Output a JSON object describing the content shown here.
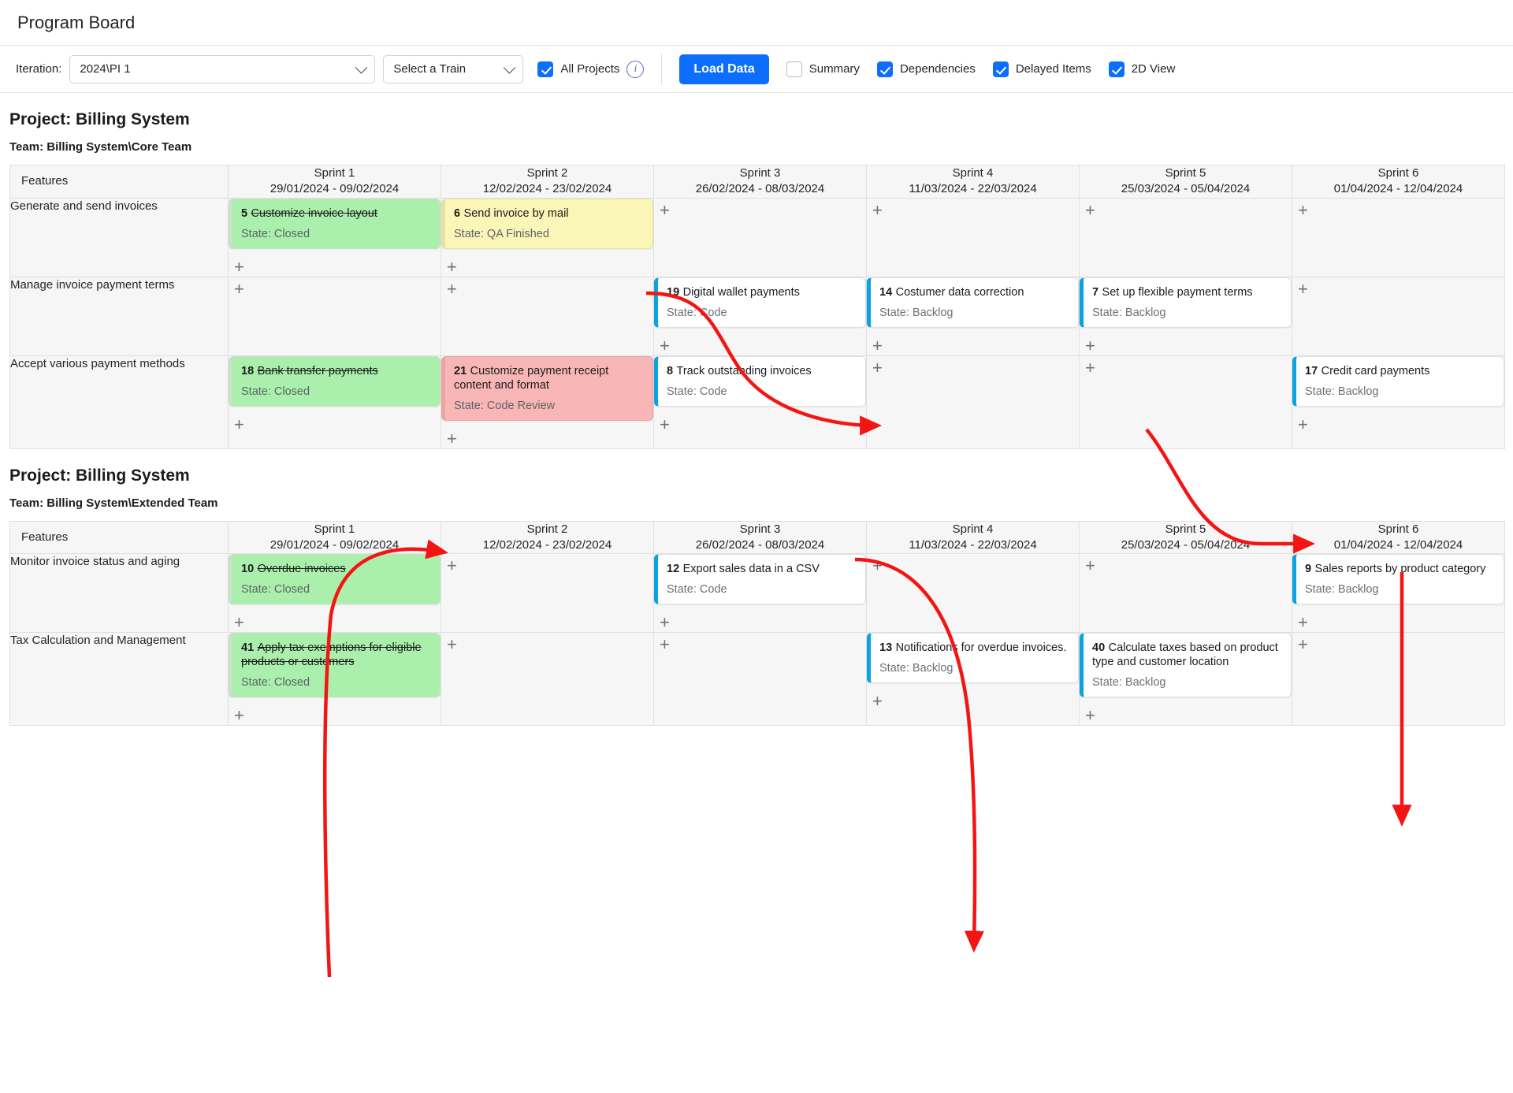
{
  "app": {
    "title": "Program Board"
  },
  "toolbar": {
    "iteration_label": "Iteration:",
    "iteration_value": "2024\\PI 1",
    "train_value": "Select a Train",
    "all_projects_label": "All Projects",
    "all_projects_checked": true,
    "info_icon": "info-icon",
    "load_data_label": "Load Data",
    "summary_label": "Summary",
    "summary_checked": false,
    "dependencies_label": "Dependencies",
    "dependencies_checked": true,
    "delayed_items_label": "Delayed Items",
    "delayed_items_checked": true,
    "two_d_view_label": "2D View",
    "two_d_view_checked": true,
    "accent_color": "#0d6efd"
  },
  "colors": {
    "card_accent": "#0aa2e0",
    "card_green": "#aaf0ac",
    "card_yellow": "#f9f6b7",
    "card_pink": "#f9b6b6",
    "arrow_red": "#f41414"
  },
  "boards": [
    {
      "project": "Project: Billing System",
      "team": "Team: Billing System\\Core Team",
      "features_header": "Features",
      "sprints": [
        {
          "name": "Sprint 1",
          "dates": "29/01/2024 - 09/02/2024"
        },
        {
          "name": "Sprint 2",
          "dates": "12/02/2024 - 23/02/2024"
        },
        {
          "name": "Sprint 3",
          "dates": "26/02/2024 - 08/03/2024"
        },
        {
          "name": "Sprint 4",
          "dates": "11/03/2024 - 22/03/2024"
        },
        {
          "name": "Sprint 5",
          "dates": "25/03/2024 - 05/04/2024"
        },
        {
          "name": "Sprint 6",
          "dates": "01/04/2024 - 12/04/2024"
        }
      ],
      "rows": [
        {
          "feature": "Generate and send invoices",
          "cells": [
            {
              "cards": [
                {
                  "id": "5",
                  "title": "Customize invoice layout",
                  "state": "State: Closed",
                  "color": "green",
                  "strike": true
                }
              ]
            },
            {
              "cards": [
                {
                  "id": "6",
                  "title": "Send invoice by mail",
                  "state": "State: QA Finished",
                  "color": "yellow",
                  "strike": false
                }
              ]
            },
            {
              "cards": []
            },
            {
              "cards": []
            },
            {
              "cards": []
            },
            {
              "cards": []
            }
          ]
        },
        {
          "feature": "Manage invoice payment terms",
          "cells": [
            {
              "cards": []
            },
            {
              "cards": []
            },
            {
              "cards": [
                {
                  "id": "19",
                  "title": "Digital wallet payments",
                  "state": "State: Code",
                  "color": "white",
                  "strike": false
                }
              ]
            },
            {
              "cards": [
                {
                  "id": "14",
                  "title": "Costumer data correction",
                  "state": "State: Backlog",
                  "color": "white",
                  "strike": false
                }
              ]
            },
            {
              "cards": [
                {
                  "id": "7",
                  "title": "Set up flexible payment terms",
                  "state": "State: Backlog",
                  "color": "white",
                  "strike": false
                }
              ]
            },
            {
              "cards": []
            }
          ]
        },
        {
          "feature": "Accept various payment methods",
          "cells": [
            {
              "cards": [
                {
                  "id": "18",
                  "title": "Bank transfer payments",
                  "state": "State: Closed",
                  "color": "green",
                  "strike": true
                }
              ]
            },
            {
              "cards": [
                {
                  "id": "21",
                  "title": "Customize payment receipt content and format",
                  "state": "State: Code Review",
                  "color": "pink",
                  "strike": false
                }
              ]
            },
            {
              "cards": [
                {
                  "id": "8",
                  "title": "Track outstanding invoices",
                  "state": "State: Code",
                  "color": "white",
                  "strike": false
                }
              ]
            },
            {
              "cards": []
            },
            {
              "cards": []
            },
            {
              "cards": [
                {
                  "id": "17",
                  "title": "Credit card payments",
                  "state": "State: Backlog",
                  "color": "white",
                  "strike": false
                }
              ]
            }
          ]
        }
      ]
    },
    {
      "project": "Project: Billing System",
      "team": "Team: Billing System\\Extended Team",
      "features_header": "Features",
      "sprints": [
        {
          "name": "Sprint 1",
          "dates": "29/01/2024 - 09/02/2024"
        },
        {
          "name": "Sprint 2",
          "dates": "12/02/2024 - 23/02/2024"
        },
        {
          "name": "Sprint 3",
          "dates": "26/02/2024 - 08/03/2024"
        },
        {
          "name": "Sprint 4",
          "dates": "11/03/2024 - 22/03/2024"
        },
        {
          "name": "Sprint 5",
          "dates": "25/03/2024 - 05/04/2024"
        },
        {
          "name": "Sprint 6",
          "dates": "01/04/2024 - 12/04/2024"
        }
      ],
      "rows": [
        {
          "feature": "Monitor invoice status and aging",
          "cells": [
            {
              "cards": [
                {
                  "id": "10",
                  "title": "Overdue invoices",
                  "state": "State: Closed",
                  "color": "green",
                  "strike": true
                }
              ]
            },
            {
              "cards": []
            },
            {
              "cards": [
                {
                  "id": "12",
                  "title": "Export sales data in a CSV",
                  "state": "State: Code",
                  "color": "white",
                  "strike": false
                }
              ]
            },
            {
              "cards": []
            },
            {
              "cards": []
            },
            {
              "cards": [
                {
                  "id": "9",
                  "title": "Sales reports by product category",
                  "state": "State: Backlog",
                  "color": "white",
                  "strike": false
                }
              ]
            }
          ]
        },
        {
          "feature": "Tax Calculation and Management",
          "cells": [
            {
              "cards": [
                {
                  "id": "41",
                  "title": "Apply tax exemptions for eligible products or customers",
                  "state": "State: Closed",
                  "color": "green",
                  "strike": true
                }
              ]
            },
            {
              "cards": []
            },
            {
              "cards": []
            },
            {
              "cards": [
                {
                  "id": "13",
                  "title": "Notifications for overdue invoices.",
                  "state": "State: Backlog",
                  "color": "white",
                  "strike": false
                }
              ]
            },
            {
              "cards": [
                {
                  "id": "40",
                  "title": "Calculate taxes based on product type and customer location",
                  "state": "State: Backlog",
                  "color": "white",
                  "strike": false
                }
              ]
            },
            {
              "cards": []
            }
          ]
        }
      ]
    }
  ],
  "dependency_arrows": [
    {
      "from": "6",
      "to": "14"
    },
    {
      "from": "7",
      "to": "17"
    },
    {
      "from": "8",
      "to": "13"
    },
    {
      "from": "17",
      "to": "9"
    },
    {
      "from": "41",
      "to": "21"
    }
  ]
}
